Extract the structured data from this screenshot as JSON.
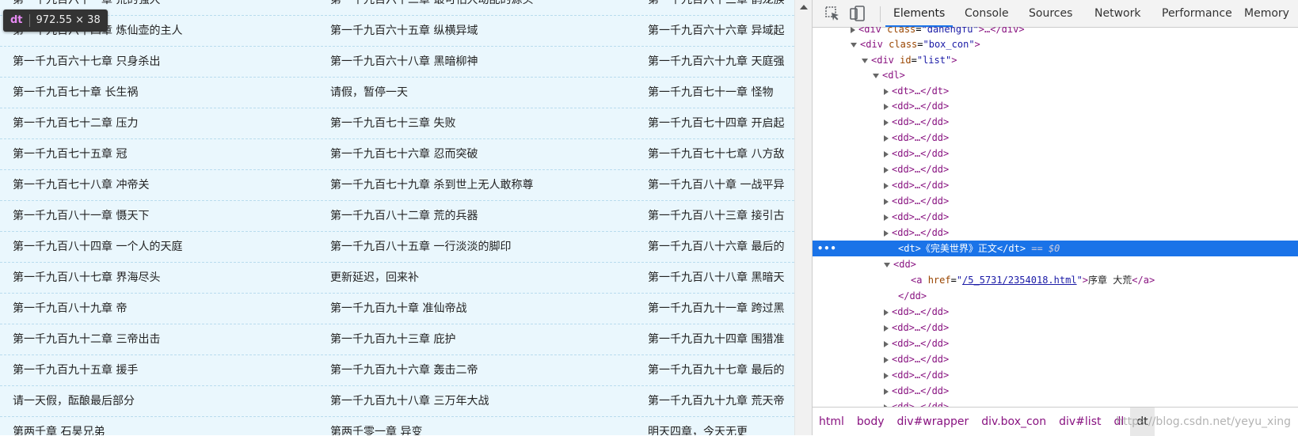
{
  "tooltip": {
    "tag": "dt",
    "dims": "972.55 × 38"
  },
  "chapters": [
    [
      "第一千九百六十一章 荒的强大",
      "第一千九百六十二章 最可怕大动乱的源头",
      "第一千九百六十三章 鹊龙族"
    ],
    [
      "第一千九百六十四章 炼仙壶的主人",
      "第一千九百六十五章 纵横异域",
      "第一千九百六十六章 异域起"
    ],
    [
      "第一千九百六十七章 只身杀出",
      "第一千九百六十八章 黑暗柳神",
      "第一千九百六十九章 天庭强"
    ],
    [
      "第一千九百七十章 长生祸",
      "请假，暂停一天",
      "第一千九百七十一章 怪物"
    ],
    [
      "第一千九百七十二章 压力",
      "第一千九百七十三章 失败",
      "第一千九百七十四章 开启起"
    ],
    [
      "第一千九百七十五章 冠",
      "第一千九百七十六章 忍而突破",
      "第一千九百七十七章 八方敌"
    ],
    [
      "第一千九百七十八章 冲帝关",
      "第一千九百七十九章 杀到世上无人敢称尊",
      "第一千九百八十章 一战平异"
    ],
    [
      "第一千九百八十一章 慑天下",
      "第一千九百八十二章 荒的兵器",
      "第一千九百八十三章 接引古"
    ],
    [
      "第一千九百八十四章 一个人的天庭",
      "第一千九百八十五章 一行淡淡的脚印",
      "第一千九百八十六章 最后的"
    ],
    [
      "第一千九百八十七章 界海尽头",
      "更新延迟，回来补",
      "第一千九百八十八章 黑暗天"
    ],
    [
      "第一千九百八十九章 帝",
      "第一千九百九十章 准仙帝战",
      "第一千九百九十一章 跨过黑"
    ],
    [
      "第一千九百九十二章 三帝出击",
      "第一千九百九十三章 庇护",
      "第一千九百九十四章 围猎准"
    ],
    [
      "第一千九百九十五章 援手",
      "第一千九百九十六章 轰击二帝",
      "第一千九百九十七章 最后的"
    ],
    [
      "请一天假，酝酿最后部分",
      "第一千九百九十八章 三万年大战",
      "第一千九百九十九章 荒天帝"
    ],
    [
      "第两千章 石昊兄弟",
      "第两千零一章 异变",
      "明天四章，今天无更"
    ]
  ],
  "devtools": {
    "tabs": [
      "Elements",
      "Console",
      "Sources",
      "Network",
      "Performance",
      "Memory"
    ],
    "active_tab": "Elements",
    "tree": {
      "n0": {
        "open": "<div",
        "attr": "class",
        "val": "dahengfu",
        "rest": ">…</div>"
      },
      "n1": {
        "open": "<div",
        "attr": "class",
        "val": "box_con",
        "rest": ">"
      },
      "n2": {
        "open": "<div",
        "attr": "id",
        "val": "list",
        "rest": ">"
      },
      "n3": {
        "open": "<dl>"
      },
      "collapsed_dt": "<dt>…</dt>",
      "collapsed_dd": "<dd>…</dd>",
      "selected": {
        "open": "<dt>",
        "text": "《完美世界》正文",
        "close": "</dt>",
        "eq": "== $0"
      },
      "dd_open": "<dd>",
      "a_open": "<a",
      "a_attr": "href",
      "a_href": "/5_5731/2354018.html",
      "a_text": "序章 大荒",
      "a_close": "</a>",
      "dd_close": "</dd>"
    },
    "breadcrumb": [
      "html",
      "body",
      "div#wrapper",
      "div.box_con",
      "div#list",
      "dl",
      "dt"
    ],
    "watermark": "https://blog.csdn.net/yeyu_xing"
  }
}
